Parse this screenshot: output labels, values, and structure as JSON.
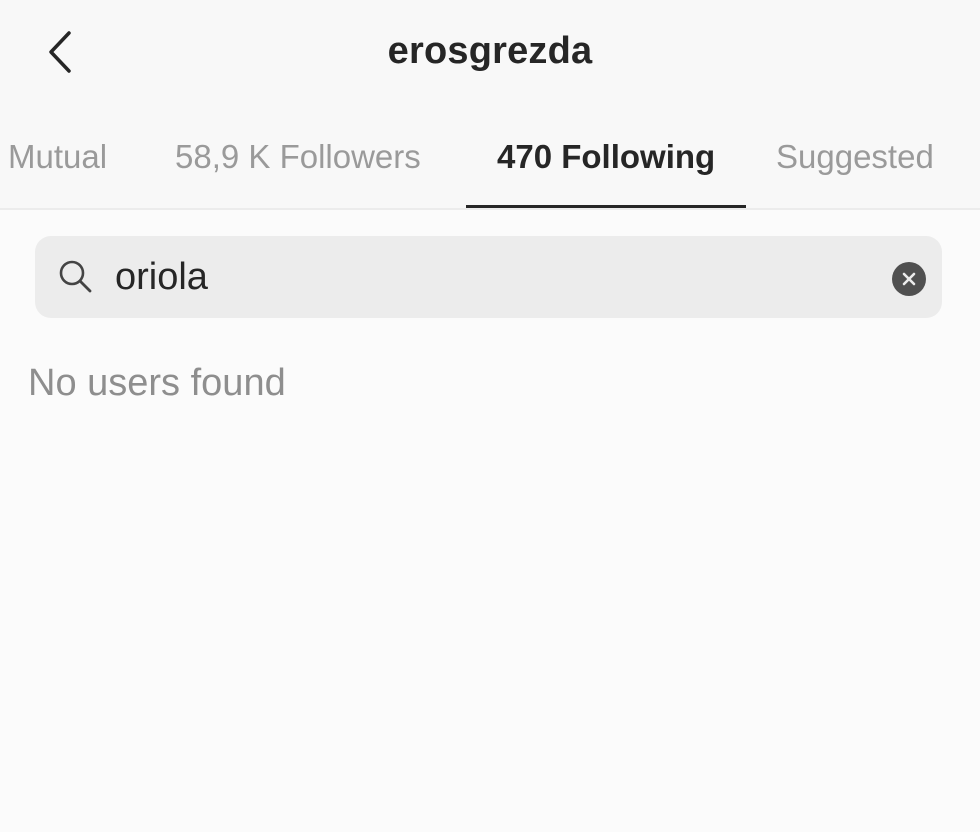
{
  "header": {
    "title": "erosgrezda"
  },
  "tabs": [
    {
      "label": "Mutual",
      "active": false
    },
    {
      "label": "58,9 K Followers",
      "active": false
    },
    {
      "label": "470 Following",
      "active": true
    },
    {
      "label": "Suggested",
      "active": false
    }
  ],
  "search": {
    "value": "oriola"
  },
  "results": {
    "empty_message": "No users found"
  },
  "colors": {
    "background": "#fbfbfb",
    "text_primary": "#262626",
    "text_muted": "#9a9a9a",
    "search_bg": "#ececec"
  },
  "icons": {
    "back": "chevron-left-icon",
    "search": "search-icon",
    "clear": "clear-x-icon"
  }
}
